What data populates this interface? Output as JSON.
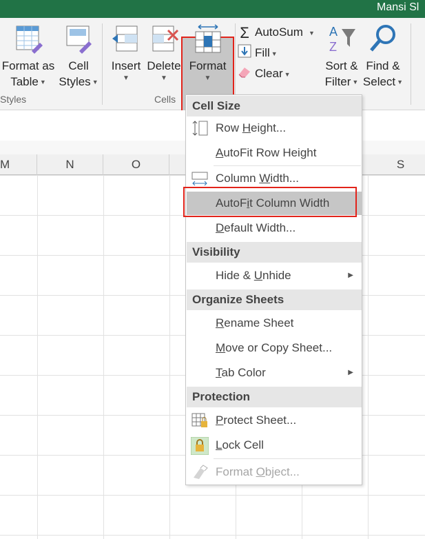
{
  "titlebar": {
    "user": "Mansi Sl"
  },
  "ribbon": {
    "styles": {
      "format_as_table": [
        "Format as",
        "Table"
      ],
      "cell_styles": [
        "Cell",
        "Styles"
      ],
      "group_label": "Styles"
    },
    "cells": {
      "insert": "Insert",
      "delete": "Delete",
      "format": "Format",
      "group_label": "Cells"
    },
    "editing": {
      "autosum": "AutoSum",
      "fill": "Fill",
      "clear": "Clear",
      "sort_filter": [
        "Sort &",
        "Filter"
      ],
      "find_select": [
        "Find &",
        "Select"
      ]
    }
  },
  "columns": [
    "M",
    "N",
    "O",
    "S"
  ],
  "menu": {
    "sections": {
      "cell_size": "Cell Size",
      "visibility": "Visibility",
      "organize": "Organize Sheets",
      "protection": "Protection"
    },
    "items": {
      "row_height": {
        "pre": "Row ",
        "key": "H",
        "post": "eight..."
      },
      "autofit_row": {
        "pre": "",
        "key": "A",
        "post": "utoFit Row Height"
      },
      "column_width": {
        "pre": "Column ",
        "key": "W",
        "post": "idth..."
      },
      "autofit_col": {
        "pre": "AutoF",
        "key": "i",
        "post": "t Column Width"
      },
      "default_width": {
        "pre": "",
        "key": "D",
        "post": "efault Width..."
      },
      "hide_unhide": {
        "pre": "Hide & ",
        "key": "U",
        "post": "nhide"
      },
      "rename": {
        "pre": "",
        "key": "R",
        "post": "ename Sheet"
      },
      "move_copy": {
        "pre": "",
        "key": "M",
        "post": "ove or Copy Sheet..."
      },
      "tab_color": {
        "pre": "",
        "key": "T",
        "post": "ab Color"
      },
      "protect": {
        "pre": "",
        "key": "P",
        "post": "rotect Sheet..."
      },
      "lock": {
        "pre": "",
        "key": "L",
        "post": "ock Cell"
      },
      "format_object": {
        "pre": "Format ",
        "key": "O",
        "post": "bject..."
      }
    }
  },
  "colors": {
    "excel_green": "#217346",
    "highlight_red": "#e2231a",
    "hover_gray": "#c6c6c6"
  }
}
